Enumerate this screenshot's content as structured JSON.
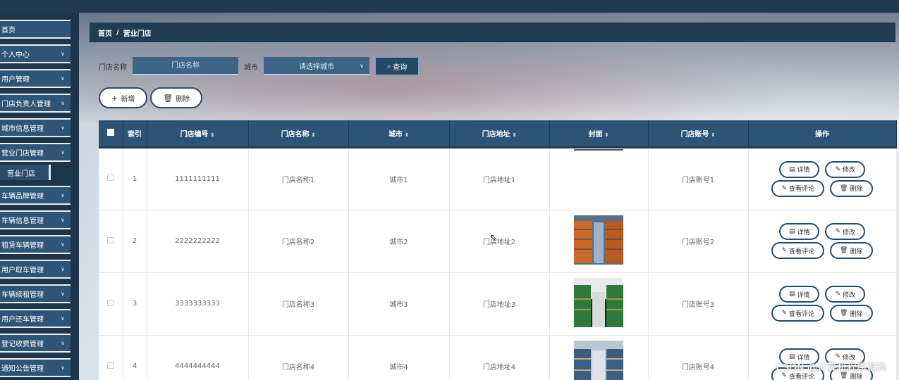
{
  "sidebar": {
    "items": [
      {
        "label": "首页",
        "chevron": false
      },
      {
        "label": "个人中心",
        "chevron": true
      },
      {
        "label": "用户管理",
        "chevron": true
      },
      {
        "label": "门店负责人管理",
        "chevron": true
      },
      {
        "label": "城市信息管理",
        "chevron": true
      },
      {
        "label": "营业门店管理",
        "chevron": true
      },
      {
        "label": "车辆品牌管理",
        "chevron": true
      },
      {
        "label": "车辆信息管理",
        "chevron": true
      },
      {
        "label": "租赁车辆管理",
        "chevron": true
      },
      {
        "label": "用户取车管理",
        "chevron": true
      },
      {
        "label": "车辆续租管理",
        "chevron": true
      },
      {
        "label": "用户还车管理",
        "chevron": true
      },
      {
        "label": "登记收费管理",
        "chevron": true
      },
      {
        "label": "通知公告管理",
        "chevron": true
      }
    ],
    "submenu": {
      "label": "营业门店"
    }
  },
  "breadcrumb": {
    "home": "首页",
    "sep": "/",
    "current": "营业门店"
  },
  "search": {
    "name_label": "门店名称",
    "name_placeholder": "门店名称",
    "city_label": "城市",
    "city_placeholder": "请选择城市",
    "query_label": "查询"
  },
  "actions": {
    "add_label": "新增",
    "delete_label": "删除"
  },
  "table": {
    "headers": {
      "index": "索引",
      "code": "门店编号",
      "name": "门店名称",
      "city": "城市",
      "address": "门店地址",
      "cover": "封面",
      "account": "门店账号",
      "ops": "操作"
    },
    "rows": [
      {
        "index": "1",
        "code": "1111111111",
        "name": "门店名称1",
        "city": "城市1",
        "address": "门店地址1",
        "account": "门店账号1",
        "cover": "none"
      },
      {
        "index": "2",
        "code": "2222222222",
        "name": "门店名称2",
        "city": "城市2",
        "address": "门店地址2",
        "account": "门店账号2",
        "cover": "warehouse-orange"
      },
      {
        "index": "3",
        "code": "3333333333",
        "name": "门店名称3",
        "city": "城市3",
        "address": "门店地址3",
        "account": "门店账号3",
        "cover": "warehouse-green"
      },
      {
        "index": "4",
        "code": "4444444444",
        "name": "门店名称4",
        "city": "城市4",
        "address": "门店地址4",
        "account": "门店账号4",
        "cover": "warehouse-blue"
      }
    ],
    "op_labels": {
      "detail": "详情",
      "edit": "修改",
      "comments": "查看评论",
      "delete": "删除"
    }
  },
  "watermark": "CSDN @计算机程序源码",
  "colors": {
    "sidebar": "#1c354b",
    "menu": "#2f5576",
    "header": "#2d5477",
    "accent_border": "#2b4a66"
  }
}
